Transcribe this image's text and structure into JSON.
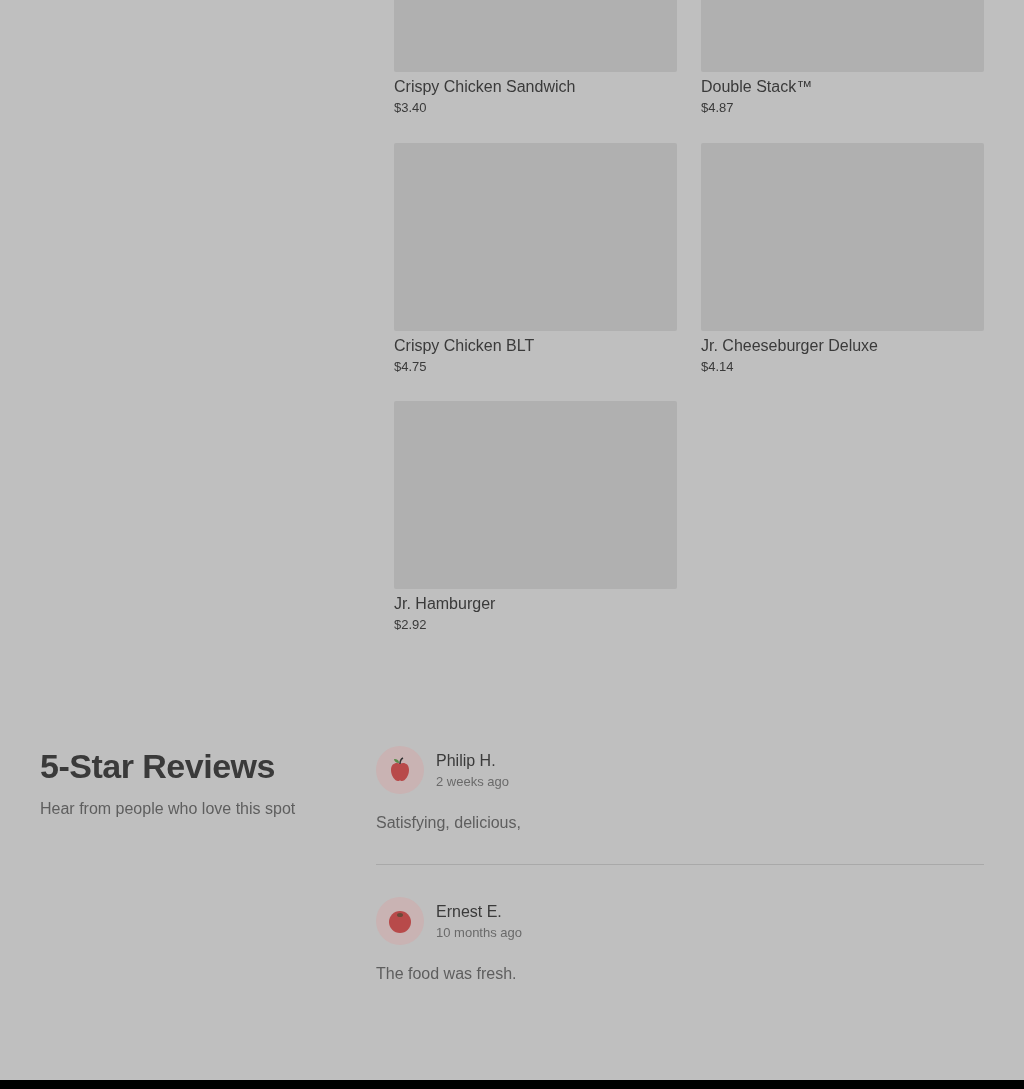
{
  "menu_items": [
    {
      "name": "Crispy Chicken Sandwich",
      "price": "$3.40"
    },
    {
      "name": "Double Stack™",
      "price": "$4.87"
    },
    {
      "name": "Crispy Chicken BLT",
      "price": "$4.75"
    },
    {
      "name": "Jr. Cheeseburger Deluxe",
      "price": "$4.14"
    },
    {
      "name": "Jr. Hamburger",
      "price": "$2.92"
    }
  ],
  "reviews_section": {
    "title": "5-Star Reviews",
    "subtitle": "Hear from people who love this spot",
    "reviews": [
      {
        "author": "Philip H.",
        "time": "2 weeks ago",
        "text": "Satisfying, delicious,",
        "kind": "apple"
      },
      {
        "author": "Ernest E.",
        "time": "10 months ago",
        "text": "The food was fresh.",
        "kind": "tomato"
      }
    ]
  }
}
